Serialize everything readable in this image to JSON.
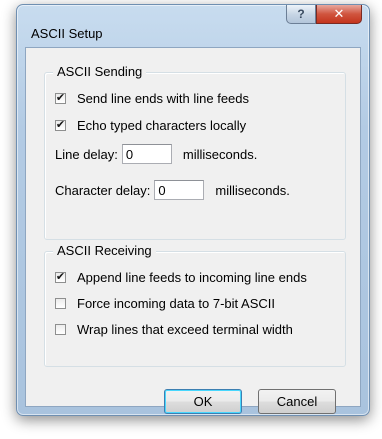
{
  "window": {
    "title": "ASCII Setup"
  },
  "caption_buttons": {
    "help_glyph": "?",
    "close_glyph": "✕"
  },
  "sending": {
    "legend": "ASCII Sending",
    "send_line_ends": {
      "label": "Send line ends with line feeds",
      "checked": true,
      "mark": "✔"
    },
    "echo_typed": {
      "label": "Echo typed characters locally",
      "checked": true,
      "mark": "✔"
    },
    "line_delay": {
      "label": "Line delay:",
      "value": "0",
      "unit": "milliseconds."
    },
    "char_delay": {
      "label": "Character delay:",
      "value": "0",
      "unit": "milliseconds."
    }
  },
  "receiving": {
    "legend": "ASCII Receiving",
    "append_line_feeds": {
      "label": "Append line feeds to incoming line ends",
      "checked": true,
      "mark": "✔"
    },
    "force_7bit": {
      "label": "Force incoming data to 7-bit ASCII",
      "checked": false,
      "mark": ""
    },
    "wrap_lines": {
      "label": "Wrap lines that exceed terminal width",
      "checked": false,
      "mark": ""
    }
  },
  "buttons": {
    "ok": "OK",
    "cancel": "Cancel"
  }
}
